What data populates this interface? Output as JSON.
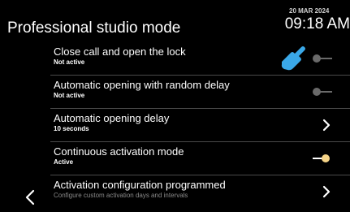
{
  "header": {
    "title": "Professional studio mode",
    "date": "20 MAR 2024",
    "time": "09:18 AM"
  },
  "rows": [
    {
      "title": "Close call and open the lock",
      "subtitle": "Not active",
      "control": "toggle",
      "state": "off"
    },
    {
      "title": "Automatic opening with random delay",
      "subtitle": "Not active",
      "control": "toggle",
      "state": "off"
    },
    {
      "title": "Automatic opening delay",
      "subtitle": "10 seconds",
      "control": "chevron"
    },
    {
      "title": "Continuous activation mode",
      "subtitle": "Active",
      "control": "toggle",
      "state": "on"
    },
    {
      "title": "Activation configuration programmed",
      "subtitle": "Configure custom activation days and intervals",
      "control": "chevron"
    }
  ],
  "icons": {
    "back": "chevron-left-icon",
    "chevron": "chevron-right-icon",
    "hand": "hand-pointer-icon"
  },
  "colors": {
    "background": "#000000",
    "accent_hand": "#3aa8e8",
    "toggle_on_knob": "#f5d487",
    "toggle_off": "#6a6a6a"
  }
}
